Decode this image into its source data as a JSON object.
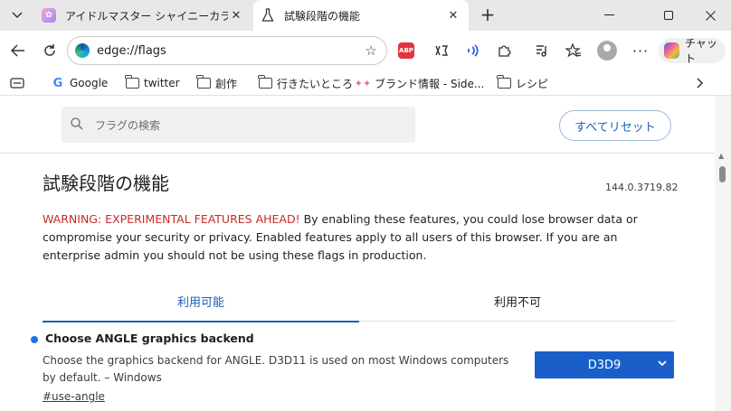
{
  "tabs": [
    {
      "title": "アイドルマスター シャイニーカラーズ",
      "active": false
    },
    {
      "title": "試験段階の機能",
      "active": true
    }
  ],
  "toolbar": {
    "url": "edge://flags",
    "abp_label": "ABP",
    "copilot_label": "チャット"
  },
  "bookmarks": [
    {
      "label": "Google",
      "icon": "google-icon"
    },
    {
      "label": "twitter",
      "icon": "folder-icon"
    },
    {
      "label": "創作",
      "icon": "folder-icon"
    },
    {
      "label": "行きたいところ",
      "icon": "folder-icon"
    },
    {
      "label": "ブランド情報 - Side...",
      "icon": "sidebar-icon"
    },
    {
      "label": "レシピ",
      "icon": "folder-icon"
    }
  ],
  "flags_page": {
    "search_placeholder": "フラグの検索",
    "reset_label": "すべてリセット",
    "title": "試験段階の機能",
    "version": "144.0.3719.82",
    "warning_red": "WARNING: EXPERIMENTAL FEATURES AHEAD!",
    "warning_rest": " By enabling these features, you could lose browser data or compromise your security or privacy. Enabled features apply to all users of this browser. If you are an enterprise admin you should not be using these flags in production.",
    "tab_available": "利用可能",
    "tab_unavailable": "利用不可",
    "flag": {
      "name": "Choose ANGLE graphics backend",
      "description": "Choose the graphics backend for ANGLE. D3D11 is used on most Windows computers by default. – Windows",
      "link": "#use-angle",
      "selected": "D3D9"
    }
  },
  "colors": {
    "accent": "#1a5fb4",
    "select_bg": "#1a5fc8",
    "warning": "#c62b2b"
  }
}
